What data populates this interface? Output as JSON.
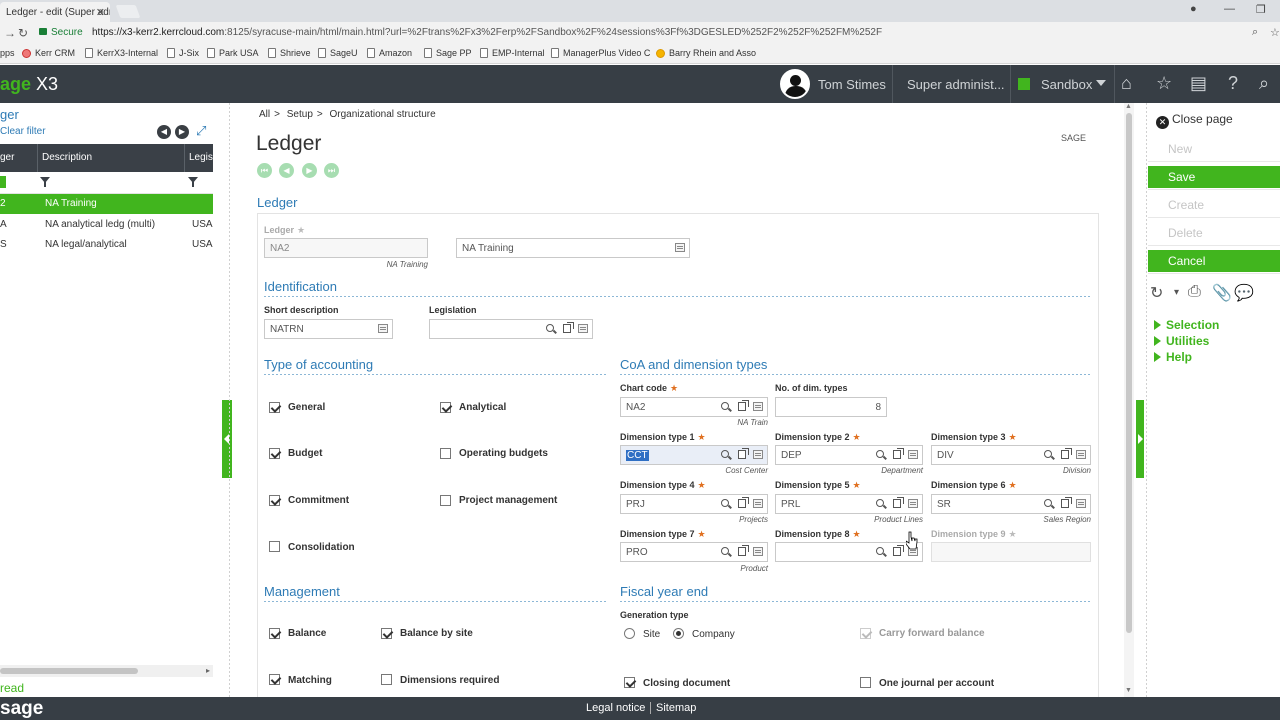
{
  "browser": {
    "tab_title": "Ledger - edit (Super adm",
    "secure_label": "Secure",
    "url_host": "https://x3-kerr2.kerrcloud.com",
    "url_rest": ":8125/syracuse-main/html/main.html?url=%2Ftrans%2Fx3%2Ferp%2FSandbox%2F%24sessions%3Ff%3DGESLED%252F2%252F%252FM%252F",
    "bookmarks": [
      "pps",
      "Kerr CRM",
      "KerrX3-Internal",
      "J-Six",
      "Park USA",
      "Shrieve",
      "SageU",
      "Amazon",
      "Sage PP",
      "EMP-Internal",
      "ManagerPlus Video C",
      "Barry Rhein and Asso"
    ]
  },
  "header": {
    "brand_sage": "age",
    "brand_x3": " X3",
    "user_name": "Tom Stimes",
    "role": "Super administ...",
    "folder": "Sandbox"
  },
  "left_panel": {
    "title": "ger",
    "clear_filter": "Clear filter",
    "columns": [
      "ger",
      "Description",
      "Legisl"
    ],
    "rows": [
      {
        "code": "2",
        "description": "NA Training",
        "legislation": ""
      },
      {
        "code": "A",
        "description": "NA analytical ledg (multi)",
        "legislation": "USA"
      },
      {
        "code": "S",
        "description": "NA legal/analytical",
        "legislation": "USA"
      }
    ],
    "status": " read"
  },
  "breadcrumb": [
    "All",
    "Setup",
    "Organizational structure"
  ],
  "page": {
    "title": "Ledger",
    "folder_code": "SAGE",
    "section_title": "Ledger"
  },
  "ledger": {
    "label": "Ledger",
    "code": "NA2",
    "code_sub": "NA Training",
    "description": "NA Training"
  },
  "identification": {
    "title": "Identification",
    "short_desc_label": "Short description",
    "short_desc_value": "NATRN",
    "legislation_label": "Legislation",
    "legislation_value": ""
  },
  "type_accounting": {
    "title": "Type of accounting",
    "general": "General",
    "analytical": "Analytical",
    "budget": "Budget",
    "operating_budgets": "Operating budgets",
    "commitment": "Commitment",
    "project_management": "Project management",
    "consolidation": "Consolidation"
  },
  "coa": {
    "title": "CoA and dimension types",
    "chart_code_label": "Chart code",
    "chart_code_value": "NA2",
    "chart_code_sub": "NA Train",
    "num_dim_label": "No. of dim. types",
    "num_dim_value": "8",
    "dims": [
      {
        "label": "Dimension type 1",
        "value": "CCT",
        "sub": "Cost Center"
      },
      {
        "label": "Dimension type 2",
        "value": "DEP",
        "sub": "Department"
      },
      {
        "label": "Dimension type 3",
        "value": "DIV",
        "sub": "Division"
      },
      {
        "label": "Dimension type 4",
        "value": "PRJ",
        "sub": "Projects"
      },
      {
        "label": "Dimension type 5",
        "value": "PRL",
        "sub": "Product Lines"
      },
      {
        "label": "Dimension type 6",
        "value": "SR",
        "sub": "Sales Region"
      },
      {
        "label": "Dimension type 7",
        "value": "PRO",
        "sub": "Product"
      },
      {
        "label": "Dimension type 8",
        "value": "",
        "sub": ""
      },
      {
        "label": "Dimension type 9",
        "value": "",
        "sub": ""
      }
    ]
  },
  "management": {
    "title": "Management",
    "balance": "Balance",
    "balance_by_site": "Balance by site",
    "matching": "Matching",
    "dimensions_required": "Dimensions required"
  },
  "fiscal": {
    "title": "Fiscal year end",
    "generation_type_label": "Generation type",
    "site": "Site",
    "company": "Company",
    "carry_forward": "Carry forward balance",
    "closing_document": "Closing document",
    "one_journal": "One journal per account"
  },
  "actions": {
    "close_page": "Close page",
    "new": "New",
    "save": "Save",
    "create": "Create",
    "delete": "Delete",
    "cancel": "Cancel",
    "selection": "Selection",
    "utilities": "Utilities",
    "help": "Help"
  },
  "footer": {
    "logo": "sage",
    "legal_notice": "Legal notice",
    "sitemap": "Sitemap"
  },
  "colors": {
    "accent_green": "#41b51e",
    "header_dark": "#373e45",
    "link_blue": "#2e7bb5"
  }
}
